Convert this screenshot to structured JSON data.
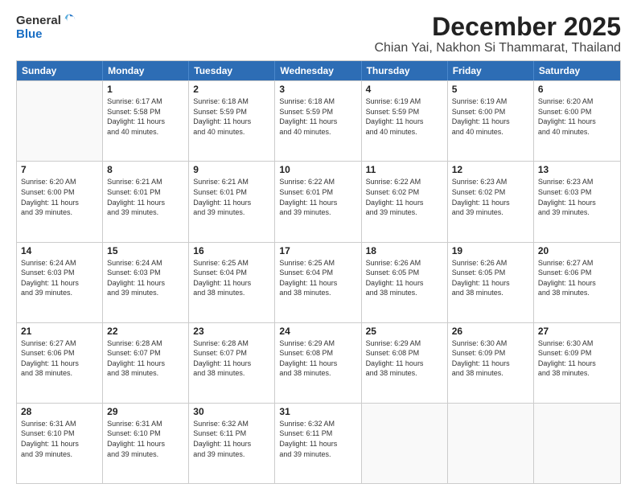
{
  "logo": {
    "general": "General",
    "blue": "Blue"
  },
  "title": "December 2025",
  "subtitle": "Chian Yai, Nakhon Si Thammarat, Thailand",
  "weekdays": [
    "Sunday",
    "Monday",
    "Tuesday",
    "Wednesday",
    "Thursday",
    "Friday",
    "Saturday"
  ],
  "weeks": [
    [
      {
        "day": "",
        "info": ""
      },
      {
        "day": "1",
        "info": "Sunrise: 6:17 AM\nSunset: 5:58 PM\nDaylight: 11 hours\nand 40 minutes."
      },
      {
        "day": "2",
        "info": "Sunrise: 6:18 AM\nSunset: 5:59 PM\nDaylight: 11 hours\nand 40 minutes."
      },
      {
        "day": "3",
        "info": "Sunrise: 6:18 AM\nSunset: 5:59 PM\nDaylight: 11 hours\nand 40 minutes."
      },
      {
        "day": "4",
        "info": "Sunrise: 6:19 AM\nSunset: 5:59 PM\nDaylight: 11 hours\nand 40 minutes."
      },
      {
        "day": "5",
        "info": "Sunrise: 6:19 AM\nSunset: 6:00 PM\nDaylight: 11 hours\nand 40 minutes."
      },
      {
        "day": "6",
        "info": "Sunrise: 6:20 AM\nSunset: 6:00 PM\nDaylight: 11 hours\nand 40 minutes."
      }
    ],
    [
      {
        "day": "7",
        "info": "Sunrise: 6:20 AM\nSunset: 6:00 PM\nDaylight: 11 hours\nand 39 minutes."
      },
      {
        "day": "8",
        "info": "Sunrise: 6:21 AM\nSunset: 6:01 PM\nDaylight: 11 hours\nand 39 minutes."
      },
      {
        "day": "9",
        "info": "Sunrise: 6:21 AM\nSunset: 6:01 PM\nDaylight: 11 hours\nand 39 minutes."
      },
      {
        "day": "10",
        "info": "Sunrise: 6:22 AM\nSunset: 6:01 PM\nDaylight: 11 hours\nand 39 minutes."
      },
      {
        "day": "11",
        "info": "Sunrise: 6:22 AM\nSunset: 6:02 PM\nDaylight: 11 hours\nand 39 minutes."
      },
      {
        "day": "12",
        "info": "Sunrise: 6:23 AM\nSunset: 6:02 PM\nDaylight: 11 hours\nand 39 minutes."
      },
      {
        "day": "13",
        "info": "Sunrise: 6:23 AM\nSunset: 6:03 PM\nDaylight: 11 hours\nand 39 minutes."
      }
    ],
    [
      {
        "day": "14",
        "info": "Sunrise: 6:24 AM\nSunset: 6:03 PM\nDaylight: 11 hours\nand 39 minutes."
      },
      {
        "day": "15",
        "info": "Sunrise: 6:24 AM\nSunset: 6:03 PM\nDaylight: 11 hours\nand 39 minutes."
      },
      {
        "day": "16",
        "info": "Sunrise: 6:25 AM\nSunset: 6:04 PM\nDaylight: 11 hours\nand 38 minutes."
      },
      {
        "day": "17",
        "info": "Sunrise: 6:25 AM\nSunset: 6:04 PM\nDaylight: 11 hours\nand 38 minutes."
      },
      {
        "day": "18",
        "info": "Sunrise: 6:26 AM\nSunset: 6:05 PM\nDaylight: 11 hours\nand 38 minutes."
      },
      {
        "day": "19",
        "info": "Sunrise: 6:26 AM\nSunset: 6:05 PM\nDaylight: 11 hours\nand 38 minutes."
      },
      {
        "day": "20",
        "info": "Sunrise: 6:27 AM\nSunset: 6:06 PM\nDaylight: 11 hours\nand 38 minutes."
      }
    ],
    [
      {
        "day": "21",
        "info": "Sunrise: 6:27 AM\nSunset: 6:06 PM\nDaylight: 11 hours\nand 38 minutes."
      },
      {
        "day": "22",
        "info": "Sunrise: 6:28 AM\nSunset: 6:07 PM\nDaylight: 11 hours\nand 38 minutes."
      },
      {
        "day": "23",
        "info": "Sunrise: 6:28 AM\nSunset: 6:07 PM\nDaylight: 11 hours\nand 38 minutes."
      },
      {
        "day": "24",
        "info": "Sunrise: 6:29 AM\nSunset: 6:08 PM\nDaylight: 11 hours\nand 38 minutes."
      },
      {
        "day": "25",
        "info": "Sunrise: 6:29 AM\nSunset: 6:08 PM\nDaylight: 11 hours\nand 38 minutes."
      },
      {
        "day": "26",
        "info": "Sunrise: 6:30 AM\nSunset: 6:09 PM\nDaylight: 11 hours\nand 38 minutes."
      },
      {
        "day": "27",
        "info": "Sunrise: 6:30 AM\nSunset: 6:09 PM\nDaylight: 11 hours\nand 38 minutes."
      }
    ],
    [
      {
        "day": "28",
        "info": "Sunrise: 6:31 AM\nSunset: 6:10 PM\nDaylight: 11 hours\nand 39 minutes."
      },
      {
        "day": "29",
        "info": "Sunrise: 6:31 AM\nSunset: 6:10 PM\nDaylight: 11 hours\nand 39 minutes."
      },
      {
        "day": "30",
        "info": "Sunrise: 6:32 AM\nSunset: 6:11 PM\nDaylight: 11 hours\nand 39 minutes."
      },
      {
        "day": "31",
        "info": "Sunrise: 6:32 AM\nSunset: 6:11 PM\nDaylight: 11 hours\nand 39 minutes."
      },
      {
        "day": "",
        "info": ""
      },
      {
        "day": "",
        "info": ""
      },
      {
        "day": "",
        "info": ""
      }
    ]
  ]
}
